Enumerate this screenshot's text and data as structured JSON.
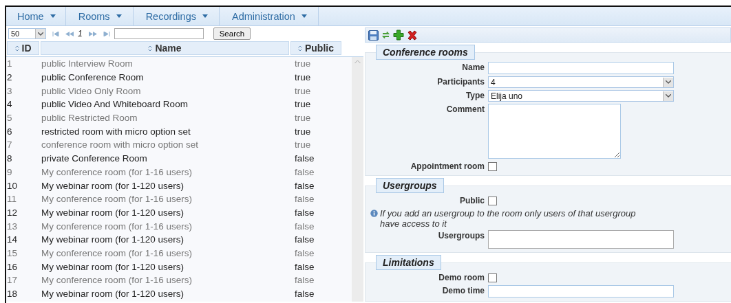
{
  "menu": [
    {
      "label": "Home"
    },
    {
      "label": "Rooms"
    },
    {
      "label": "Recordings"
    },
    {
      "label": "Administration"
    }
  ],
  "pager": {
    "page_size": "50",
    "page": "1",
    "search_button": "Search"
  },
  "table": {
    "columns": [
      {
        "label": "ID"
      },
      {
        "label": "Name"
      },
      {
        "label": "Public"
      }
    ],
    "rows": [
      {
        "id": "1",
        "name": "public Interview Room",
        "public": "true"
      },
      {
        "id": "2",
        "name": "public Conference Room",
        "public": "true"
      },
      {
        "id": "3",
        "name": "public Video Only Room",
        "public": "true"
      },
      {
        "id": "4",
        "name": "public Video And Whiteboard Room",
        "public": "true"
      },
      {
        "id": "5",
        "name": "public Restricted Room",
        "public": "true"
      },
      {
        "id": "6",
        "name": "restricted room with micro option set",
        "public": "true"
      },
      {
        "id": "7",
        "name": "conference room with micro option set",
        "public": "true"
      },
      {
        "id": "8",
        "name": "private Conference Room",
        "public": "false"
      },
      {
        "id": "9",
        "name": "My conference room (for 1-16 users)",
        "public": "false"
      },
      {
        "id": "10",
        "name": "My webinar room (for 1-120 users)",
        "public": "false"
      },
      {
        "id": "11",
        "name": "My conference room (for 1-16 users)",
        "public": "false"
      },
      {
        "id": "12",
        "name": "My webinar room (for 1-120 users)",
        "public": "false"
      },
      {
        "id": "13",
        "name": "My conference room (for 1-16 users)",
        "public": "false"
      },
      {
        "id": "14",
        "name": "My webinar room (for 1-120 users)",
        "public": "false"
      },
      {
        "id": "15",
        "name": "My conference room (for 1-16 users)",
        "public": "false"
      },
      {
        "id": "16",
        "name": "My webinar room (for 1-120 users)",
        "public": "false"
      },
      {
        "id": "17",
        "name": "My conference room (for 1-16 users)",
        "public": "false"
      },
      {
        "id": "18",
        "name": "My webinar room (for 1-120 users)",
        "public": "false"
      }
    ]
  },
  "form": {
    "sections": [
      {
        "title": "Conference rooms",
        "fields": [
          {
            "kind": "text",
            "label": "Name"
          },
          {
            "kind": "select",
            "label": "Participants",
            "value": "4"
          },
          {
            "kind": "select",
            "label": "Type",
            "value": "Elija uno"
          },
          {
            "kind": "textarea",
            "label": "Comment"
          },
          {
            "kind": "checkbox",
            "label": "Appointment room",
            "checked": false
          }
        ]
      },
      {
        "title": "Usergroups",
        "fields": [
          {
            "kind": "checkbox",
            "label": "Public",
            "checked": false
          },
          {
            "kind": "note",
            "text": "If you add an usergroup to the room only users of that usergroup have access to it"
          },
          {
            "kind": "list",
            "label": "Usergroups"
          }
        ]
      },
      {
        "title": "Limitations",
        "fields": [
          {
            "kind": "checkbox",
            "label": "Demo room",
            "checked": false
          },
          {
            "kind": "text",
            "label": "Demo time"
          }
        ]
      }
    ]
  }
}
